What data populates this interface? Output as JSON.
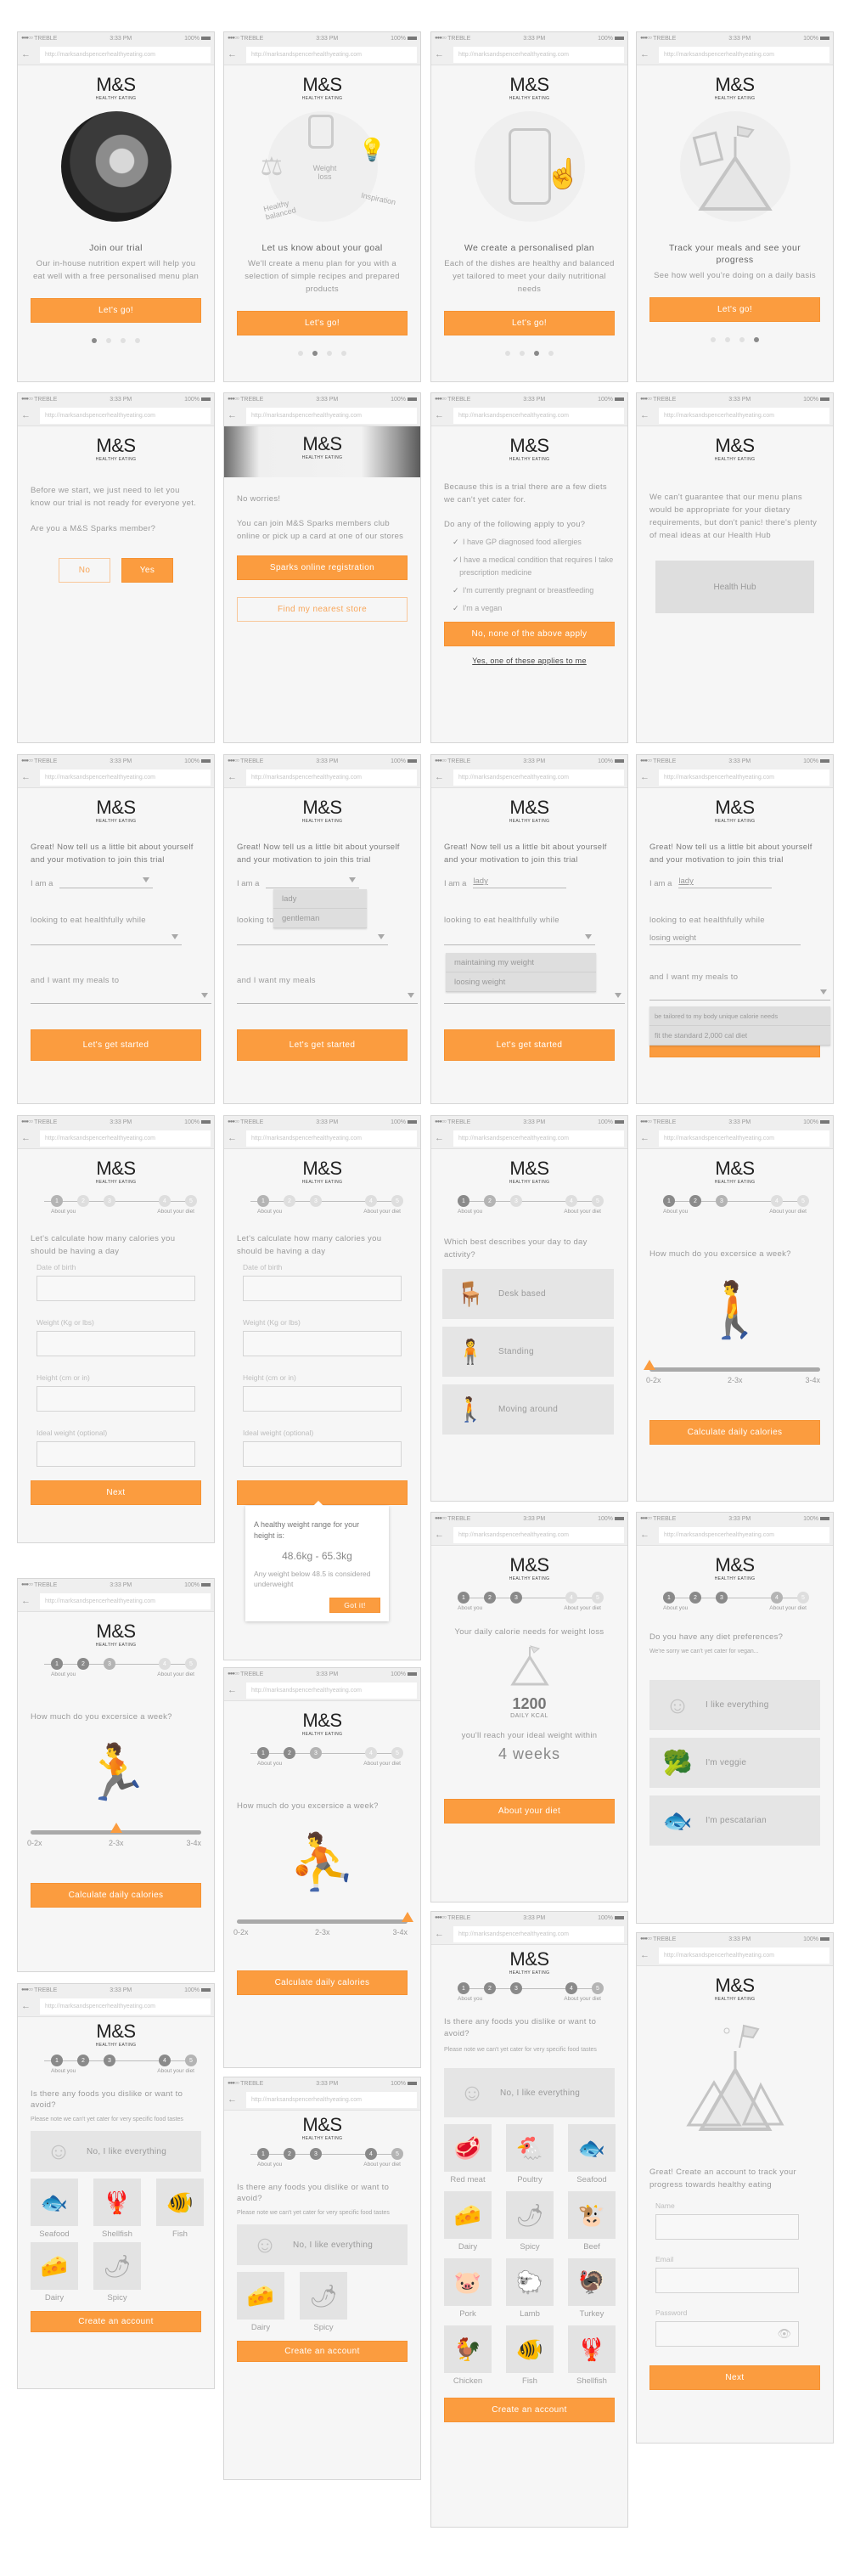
{
  "status_bar": {
    "carrier": "TREBLE",
    "time": "3:33 PM",
    "battery": "100%"
  },
  "browser": {
    "url": "http://marksandspencerhealthyeating.com",
    "back_icon": "arrow-left-icon"
  },
  "logo": {
    "brand": "M&S",
    "subtitle": "HEALTHY EATING"
  },
  "colors": {
    "accent": "#fb9c3f",
    "background": "#f6f6f6",
    "tile": "#e3e3e3",
    "text": "#9a9a9a"
  },
  "screens": {
    "onboard1": {
      "headline": "Join our trial",
      "body": "Our in-house nutrition expert will help you eat well with a free personalised menu plan",
      "button": "Let's go!",
      "page": 1,
      "pages": 4
    },
    "onboard2": {
      "headline": "Let us know about your goal",
      "body": "We'll create a menu plan for you with a selection of simple recipes and prepared products",
      "button": "Let's go!",
      "labels": [
        "Weight loss",
        "Healthy balanced",
        "Inspiration"
      ],
      "page": 2,
      "pages": 4
    },
    "onboard3": {
      "headline": "We create a personalised plan",
      "body": "Each of the dishes are healthy and balanced yet tailored to meet your daily nutritional needs",
      "button": "Let's go!",
      "page": 3,
      "pages": 4
    },
    "onboard4": {
      "headline": "Track your meals and see your progress",
      "body": "See how well you're doing on a daily basis",
      "button": "Let's go!",
      "page": 4,
      "pages": 4
    },
    "sparks": {
      "intro": "Before we start, we just need to let you know our trial is not ready for everyone yet.",
      "question": "Are you a M&S Sparks member?",
      "no": "No",
      "yes": "Yes"
    },
    "noworries": {
      "title": "No worries!",
      "body": "You can join M&S Sparks members club online or pick up a card at one of our stores",
      "primary": "Sparks online registration",
      "secondary": "Find my nearest store"
    },
    "diets": {
      "intro": "Because this is a trial there are a few diets we can't yet cater for.",
      "question": "Do any of the following apply to you?",
      "items": [
        "I have GP diagnosed food allergies",
        "I have a medical condition that requires I take prescription medicine",
        "I'm currently pregnant or breastfeeding",
        "I'm a vegan"
      ],
      "primary": "No, none of the above apply",
      "link": "Yes, one of these applies to me"
    },
    "healthhub": {
      "body": "We can't guarantee that our menu plans would be appropriate for your dietary requirements, but don't panic! there's plenty of meal ideas at our Health Hub",
      "button": "Health Hub"
    },
    "about": {
      "headline": "Great! Now tell us a little bit about yourself and your motivation to join this trial",
      "iam": "I am a",
      "looking": "looking to eat healthfully while",
      "meals": "and I want my meals to",
      "meals_short": "and I want my meals",
      "button": "Let's get started",
      "gender_options": [
        "lady",
        "gentleman"
      ],
      "gender_value": "lady",
      "goal_options": [
        "maintaining my weight",
        "loosing weight"
      ],
      "goal_value": "losing weight",
      "meal_options": [
        "be tailored to my body unique calorie needs",
        "fit the standard 2,000 cal diet"
      ]
    },
    "stepper": {
      "start_label": "About you",
      "end_label": "About your diet",
      "steps": [
        "1",
        "2",
        "3",
        "4",
        "5"
      ]
    },
    "calc": {
      "headline": "Let's calculate how many calories you should be having a day",
      "fields": [
        "Date of birth",
        "Weight (Kg or lbs)",
        "Height (cm or in)",
        "Ideal weight (optional)"
      ],
      "button": "Next",
      "popup": {
        "title": "A healthy weight range for your height is:",
        "range": "48.6kg - 65.3kg",
        "note": "Any weight below 48.5 is considered underweight",
        "button": "Got it!"
      }
    },
    "activity": {
      "question": "Which best describes your day to day activity?",
      "options": [
        {
          "label": "Desk based",
          "icon": "desk-person-icon"
        },
        {
          "label": "Standing",
          "icon": "standing-person-icon"
        },
        {
          "label": "Moving around",
          "icon": "walking-person-icon"
        }
      ]
    },
    "exercise": {
      "question": "How much do you excersice a week?",
      "ticks": [
        "0-2x",
        "2-3x",
        "3-4x"
      ],
      "button": "Calculate daily calories",
      "selections": [
        "0-2x",
        "2-3x",
        "3-4x"
      ]
    },
    "result": {
      "headline": "Your daily calorie needs for weight loss",
      "kcal": "1200",
      "kcal_label": "DAILY KCAL",
      "reach": "you'll reach your ideal weight within",
      "weeks": "4 weeks",
      "button": "About your diet"
    },
    "prefs": {
      "question": "Do you have any diet preferences?",
      "note": "We're sorry we can't yet cater for vegan...",
      "options": [
        {
          "label": "I like everything",
          "icon": "smiley-icon"
        },
        {
          "label": "I'm veggie",
          "icon": "broccoli-icon"
        },
        {
          "label": "I'm pescatarian",
          "icon": "fish-icon"
        }
      ]
    },
    "dislikes": {
      "question": "Is there any foods you dislike or want to avoid?",
      "note": "Please note we can't yet cater for very specific food tastes",
      "everything": "No, I like everything",
      "button": "Create an account",
      "set1": [
        "Seafood",
        "Shellfish",
        "Fish",
        "Dairy",
        "Spicy"
      ],
      "set2": [
        "Dairy",
        "Spicy"
      ],
      "set3": [
        "Red meat",
        "Poultry",
        "Seafood",
        "Dairy",
        "Spicy",
        "Beef",
        "Pork",
        "Lamb",
        "Turkey",
        "Chicken",
        "Fish",
        "Shellfish"
      ]
    },
    "account": {
      "body": "Great! Create an account to track your progress towards healthy eating",
      "fields": [
        "Name",
        "Email",
        "Password"
      ],
      "button": "Next"
    }
  }
}
